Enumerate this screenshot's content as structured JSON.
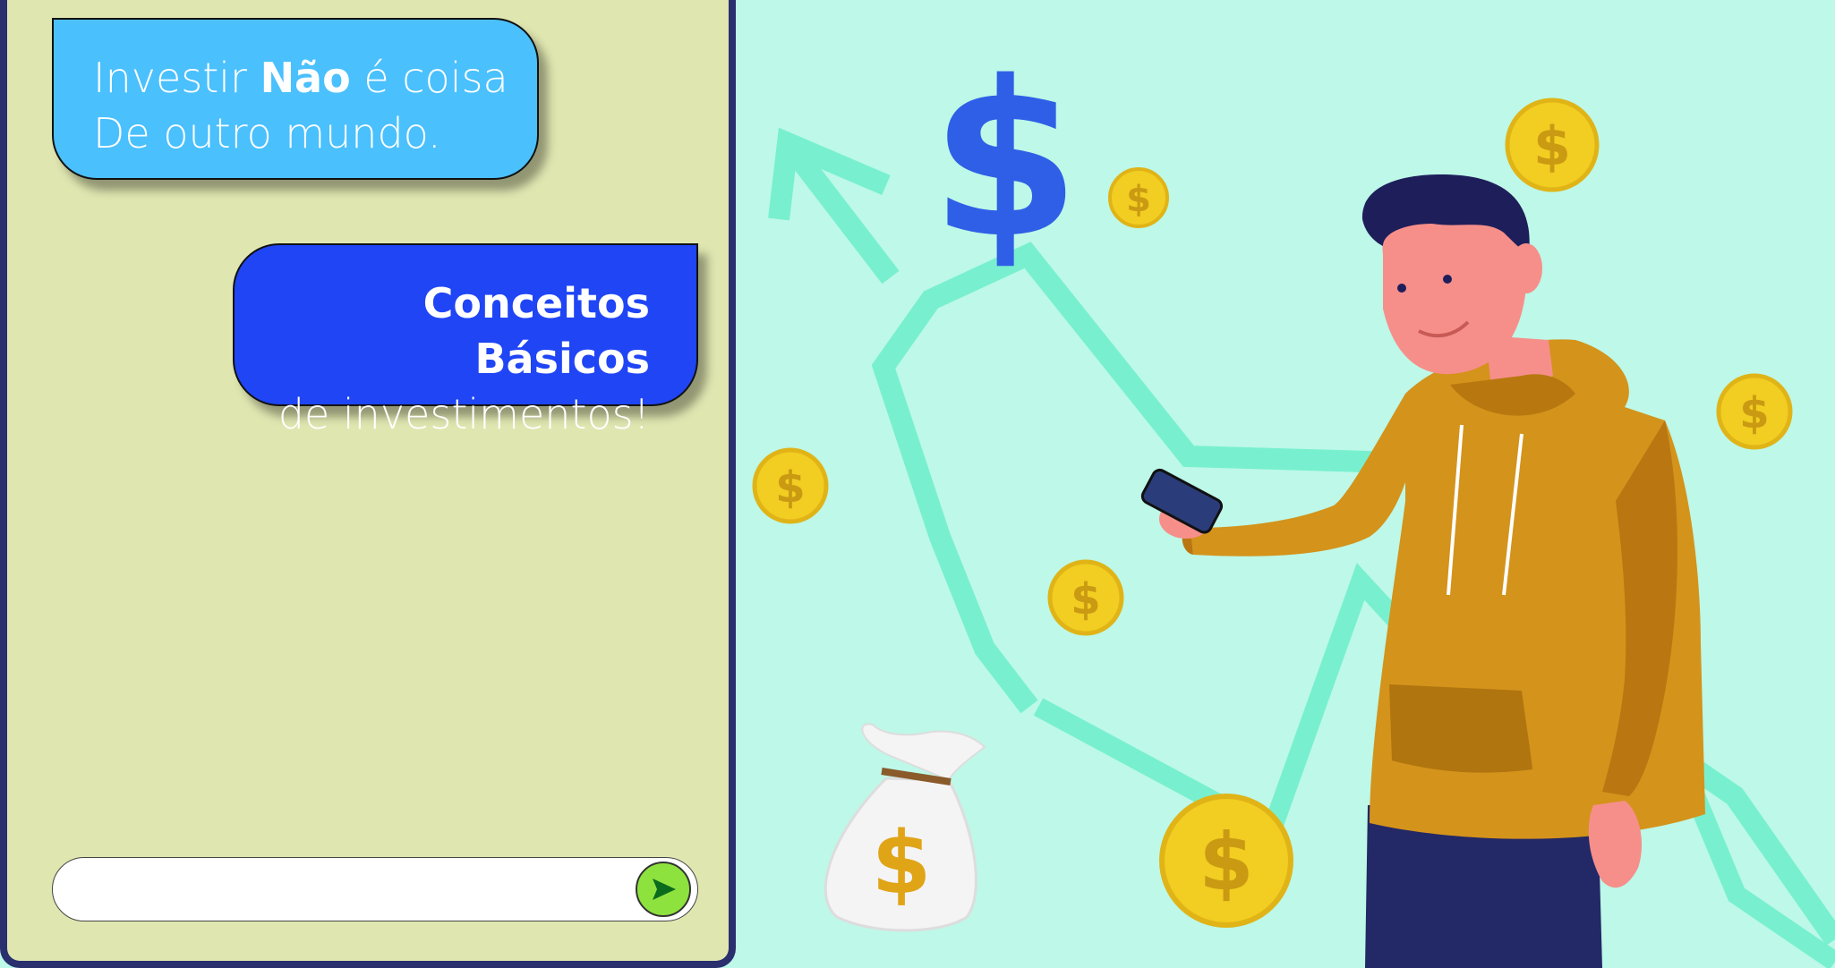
{
  "chat": {
    "message1": {
      "line1_prefix": "Investir ",
      "line1_bold": "Não",
      "line1_suffix": " é coisa",
      "line2": "De outro mundo."
    },
    "message2": {
      "line1": "Conceitos Básicos",
      "line2": "de investimentos!"
    },
    "input": {
      "value": "",
      "placeholder": ""
    },
    "send_icon": "play-arrow-icon"
  },
  "illustration": {
    "coin_symbol": "$",
    "bag_symbol": "$",
    "big_symbol": "$"
  },
  "colors": {
    "panel_bg": "#dfe6b0",
    "panel_border": "#2a2f6e",
    "bubble1": "#4ac0fd",
    "bubble2": "#1f45f5",
    "scene_bg": "#bdf8e8",
    "send_button": "#8ee23e",
    "coin": "#f2cd22"
  }
}
